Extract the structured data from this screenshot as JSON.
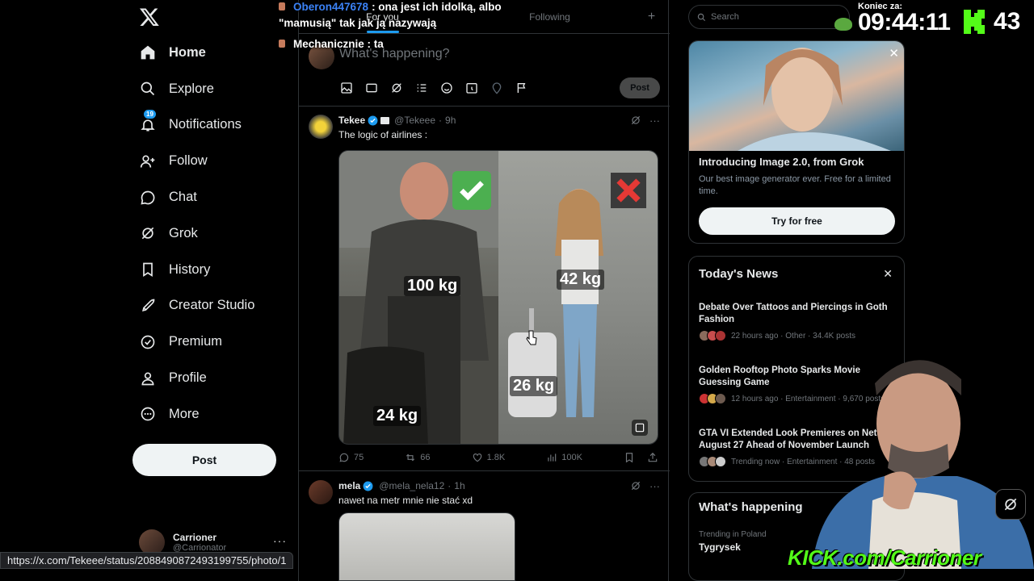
{
  "sidebar": {
    "logo": "x-logo-icon",
    "items": [
      {
        "label": "Home",
        "icon": "home-icon",
        "active": true
      },
      {
        "label": "Explore",
        "icon": "search-icon"
      },
      {
        "label": "Notifications",
        "icon": "bell-icon",
        "badge": "19"
      },
      {
        "label": "Follow",
        "icon": "person-add-icon"
      },
      {
        "label": "Chat",
        "icon": "chat-icon"
      },
      {
        "label": "Grok",
        "icon": "grok-icon"
      },
      {
        "label": "History",
        "icon": "bookmark-icon"
      },
      {
        "label": "Creator Studio",
        "icon": "rocket-icon"
      },
      {
        "label": "Premium",
        "icon": "verified-icon"
      },
      {
        "label": "Profile",
        "icon": "profile-icon"
      },
      {
        "label": "More",
        "icon": "more-circle-icon"
      }
    ],
    "post_label": "Post",
    "account": {
      "name": "Carrioner",
      "handle": "@Carrionator",
      "more": "···"
    }
  },
  "chat_overlay": [
    {
      "user": "Oberon447678",
      "text": ": ona jest ich idolką, albo"
    },
    {
      "user": "",
      "text": "\"mamusią\" tak jak ją nazywają"
    },
    {
      "user": "",
      "text": "Mechanicznie : ta"
    }
  ],
  "timeline": {
    "tabs": [
      {
        "label": "For you",
        "active": true
      },
      {
        "label": "Following"
      }
    ],
    "tab_add": "+",
    "composer": {
      "placeholder": "What's happening?",
      "post_label": "Post"
    },
    "tweets": [
      {
        "name": "Tekee",
        "handle": "@Tekeee",
        "time": "9h",
        "text": "The logic of airlines :",
        "media_labels": {
          "man": "100 kg",
          "man_bag": "24 kg",
          "woman": "42 kg",
          "woman_bag": "26 kg"
        },
        "stats": {
          "replies": "75",
          "reposts": "66",
          "likes": "1.8K",
          "views": "100K"
        }
      },
      {
        "name": "mela",
        "handle": "@mela_nela12",
        "time": "1h",
        "text": "nawet na metr mnie nie stać xd"
      }
    ]
  },
  "right": {
    "search_placeholder": "Search",
    "promo": {
      "title": "Introducing Image 2.0, from Grok",
      "desc": "Our best image generator ever. Free for a limited time.",
      "button": "Try for free"
    },
    "news": {
      "title": "Today's News",
      "items": [
        {
          "headline": "Debate Over Tattoos and Piercings in Goth Fashion",
          "meta": "22 hours ago · Other · 34.4K posts"
        },
        {
          "headline": "Golden Rooftop Photo Sparks Movie Guessing Game",
          "meta": "12 hours ago · Entertainment · 9,670 posts"
        },
        {
          "headline": "GTA VI Extended Look Premieres on Netfli August 27 Ahead of November Launch",
          "meta": "Trending now · Entertainment · 48 posts"
        }
      ]
    },
    "happening": {
      "title": "What's happening",
      "sub": "Trending in Poland",
      "topic": "Tygrysek"
    }
  },
  "stream": {
    "timer_label": "Koniec za:",
    "timer": "09:44:11",
    "kick_count": "43",
    "kick_url": "KICK.com/Carrioner"
  },
  "statusbar_url": "https://x.com/Tekeee/status/2088490872493199755/photo/1",
  "colors": {
    "accent": "#1d9bf0",
    "kick_green": "#53fc18",
    "bg": "#000000"
  }
}
